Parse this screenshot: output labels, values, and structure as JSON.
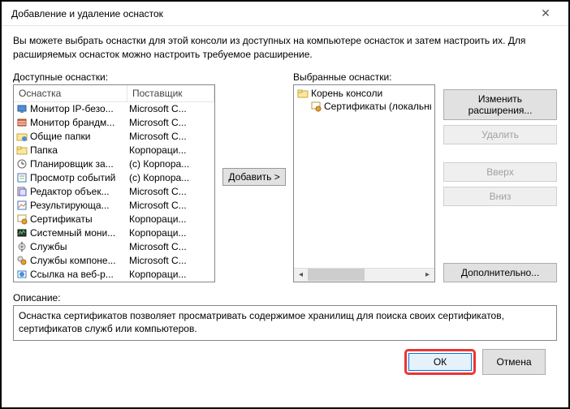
{
  "window": {
    "title": "Добавление и удаление оснасток"
  },
  "intro": "Вы можете выбрать оснастки для этой консоли из доступных на компьютере оснасток и затем настроить их. Для расширяемых оснасток можно настроить требуемое расширение.",
  "labels": {
    "available": "Доступные оснастки:",
    "selected": "Выбранные оснастки:",
    "description": "Описание:"
  },
  "columns": {
    "snapin": "Оснастка",
    "vendor": "Поставщик"
  },
  "available_snapins": [
    {
      "name": "Монитор IP-безо...",
      "vendor": "Microsoft C...",
      "icon": "monitor"
    },
    {
      "name": "Монитор брандм...",
      "vendor": "Microsoft C...",
      "icon": "firewall"
    },
    {
      "name": "Общие папки",
      "vendor": "Microsoft C...",
      "icon": "folder-share"
    },
    {
      "name": "Папка",
      "vendor": "Корпораци...",
      "icon": "folder"
    },
    {
      "name": "Планировщик за...",
      "vendor": "(c) Корпора...",
      "icon": "clock"
    },
    {
      "name": "Просмотр событий",
      "vendor": "(c) Корпора...",
      "icon": "events"
    },
    {
      "name": "Редактор объек...",
      "vendor": "Microsoft C...",
      "icon": "gpedit"
    },
    {
      "name": "Результирующа...",
      "vendor": "Microsoft C...",
      "icon": "results"
    },
    {
      "name": "Сертификаты",
      "vendor": "Корпораци...",
      "icon": "cert"
    },
    {
      "name": "Системный мони...",
      "vendor": "Корпораци...",
      "icon": "sysmon"
    },
    {
      "name": "Службы",
      "vendor": "Microsoft C...",
      "icon": "services"
    },
    {
      "name": "Службы компоне...",
      "vendor": "Microsoft C...",
      "icon": "comp-svc"
    },
    {
      "name": "Ссылка на веб-р...",
      "vendor": "Корпораци...",
      "icon": "web-link"
    }
  ],
  "selected_tree": {
    "root": "Корень консоли",
    "child": "Сертификаты (локальный ко"
  },
  "buttons": {
    "add": "Добавить >",
    "edit_ext": "Изменить расширения...",
    "remove": "Удалить",
    "up": "Вверх",
    "down": "Вниз",
    "advanced": "Дополнительно...",
    "ok": "ОК",
    "cancel": "Отмена"
  },
  "description_text": "Оснастка сертификатов позволяет просматривать содержимое хранилищ для поиска своих сертификатов, сертификатов служб или компьютеров."
}
